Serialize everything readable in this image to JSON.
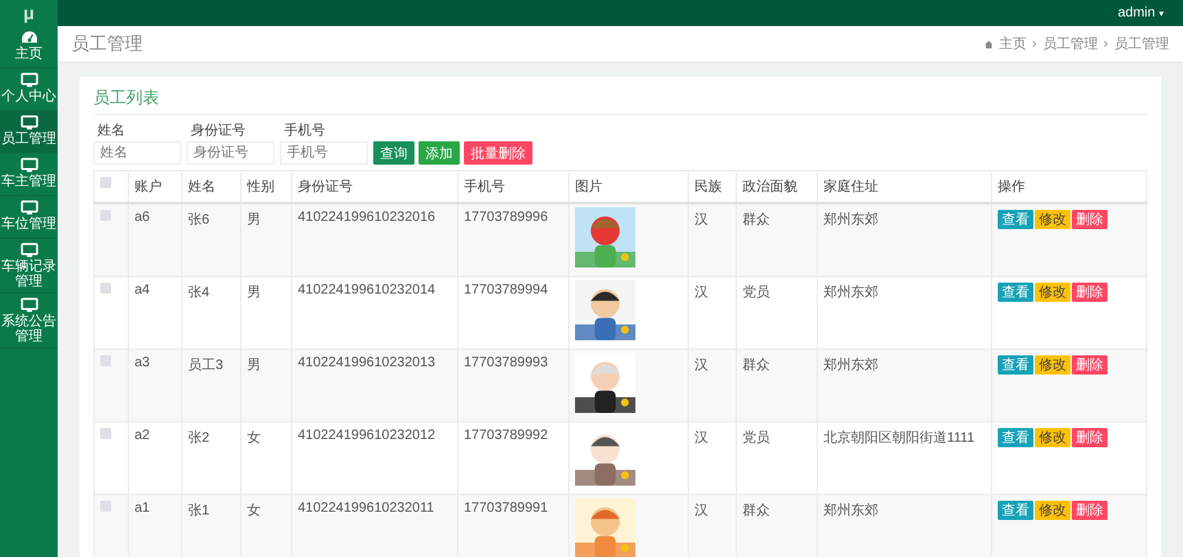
{
  "logo": "μ",
  "user_menu": {
    "label": "admin",
    "caret": "▾"
  },
  "sidebar": {
    "items": [
      {
        "label": "主页",
        "selected": false
      },
      {
        "label": "个人中心",
        "selected": false
      },
      {
        "label": "员工管理",
        "selected": true
      },
      {
        "label": "车主管理",
        "selected": false
      },
      {
        "label": "车位管理",
        "selected": false
      },
      {
        "label": "车辆记录管理",
        "selected": false
      },
      {
        "label": "系统公告管理",
        "selected": false
      }
    ]
  },
  "page_title": "员工管理",
  "breadcrumb": [
    "主页",
    "员工管理",
    "员工管理"
  ],
  "card": {
    "title": "员工列表",
    "filters": [
      {
        "label": "姓名",
        "placeholder": "姓名"
      },
      {
        "label": "身份证号",
        "placeholder": "身份证号"
      },
      {
        "label": "手机号",
        "placeholder": "手机号"
      }
    ],
    "buttons": [
      {
        "label": "查询",
        "kind": "primary"
      },
      {
        "label": "添加",
        "kind": "success"
      },
      {
        "label": "批量删除",
        "kind": "danger"
      }
    ],
    "table": {
      "select_all_checked": false,
      "columns": [
        "账户",
        "姓名",
        "性别",
        "身份证号",
        "手机号",
        "图片",
        "民族",
        "政治面貌",
        "家庭住址",
        "操作"
      ],
      "rows": [
        {
          "checked": false,
          "cells": [
            "a6",
            "张6",
            "男",
            "410224199610232016",
            "17703789996"
          ],
          "rest": [
            "汉",
            "群众",
            "郑州东郊"
          ],
          "actions": [
            {
              "label": "查看",
              "kind": "info"
            },
            {
              "label": "修改",
              "kind": "warning"
            },
            {
              "label": "删除",
              "kind": "danger"
            }
          ]
        },
        {
          "checked": false,
          "cells": [
            "a4",
            "张4",
            "男",
            "410224199610232014",
            "17703789994"
          ],
          "rest": [
            "汉",
            "党员",
            "郑州东郊"
          ],
          "actions": [
            {
              "label": "查看",
              "kind": "info"
            },
            {
              "label": "修改",
              "kind": "warning"
            },
            {
              "label": "删除",
              "kind": "danger"
            }
          ]
        },
        {
          "checked": false,
          "cells": [
            "a3",
            "员工3",
            "男",
            "410224199610232013",
            "17703789993"
          ],
          "rest": [
            "汉",
            "群众",
            "郑州东郊"
          ],
          "actions": [
            {
              "label": "查看",
              "kind": "info"
            },
            {
              "label": "修改",
              "kind": "warning"
            },
            {
              "label": "删除",
              "kind": "danger"
            }
          ]
        },
        {
          "checked": false,
          "cells": [
            "a2",
            "张2",
            "女",
            "410224199610232012",
            "17703789992"
          ],
          "rest": [
            "汉",
            "党员",
            "北京朝阳区朝阳街道1111"
          ],
          "actions": [
            {
              "label": "查看",
              "kind": "info"
            },
            {
              "label": "修改",
              "kind": "warning"
            },
            {
              "label": "删除",
              "kind": "danger"
            }
          ]
        },
        {
          "checked": false,
          "cells": [
            "a1",
            "张1",
            "女",
            "410224199610232011",
            "17703789991"
          ],
          "rest": [
            "汉",
            "群众",
            "郑州东郊"
          ],
          "actions": [
            {
              "label": "查看",
              "kind": "info"
            },
            {
              "label": "修改",
              "kind": "warning"
            },
            {
              "label": "删除",
              "kind": "danger"
            }
          ]
        }
      ]
    }
  }
}
